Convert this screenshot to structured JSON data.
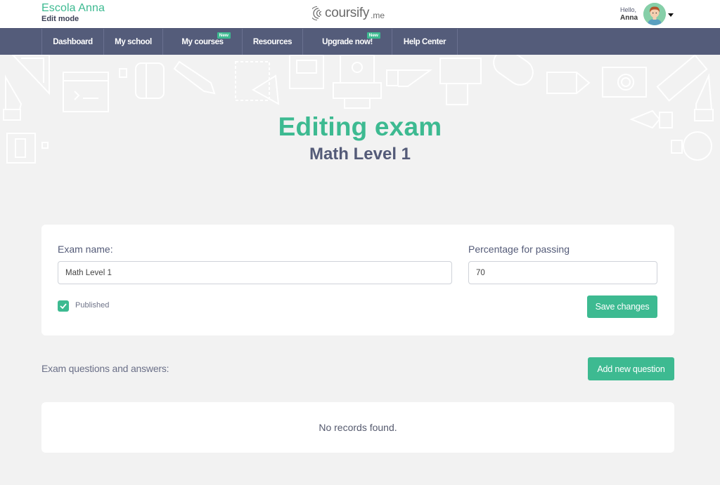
{
  "header": {
    "school_name": "Escola Anna",
    "mode": "Edit mode",
    "logo_text": "coursify",
    "logo_suffix": ".me",
    "greeting": "Hello,",
    "user_name": "Anna"
  },
  "nav": {
    "items": [
      {
        "label": "Dashboard",
        "badge": null
      },
      {
        "label": "My school",
        "badge": null
      },
      {
        "label": "My courses",
        "badge": "New"
      },
      {
        "label": "Resources",
        "badge": null
      },
      {
        "label": "Upgrade now!",
        "badge": "New"
      },
      {
        "label": "Help Center",
        "badge": null
      }
    ]
  },
  "hero": {
    "title": "Editing exam",
    "subtitle": "Math Level 1"
  },
  "form": {
    "exam_name_label": "Exam name:",
    "exam_name_value": "Math Level 1",
    "passing_label": "Percentage for passing",
    "passing_value": "70",
    "published_label": "Published",
    "published_checked": true,
    "save_label": "Save changes"
  },
  "questions": {
    "section_label": "Exam questions and answers:",
    "add_label": "Add new question",
    "empty_text": "No records found."
  },
  "colors": {
    "accent": "#3dba91",
    "nav_bg": "#545c7a",
    "heading": "#545b78",
    "page_bg": "#f2f2f2"
  }
}
